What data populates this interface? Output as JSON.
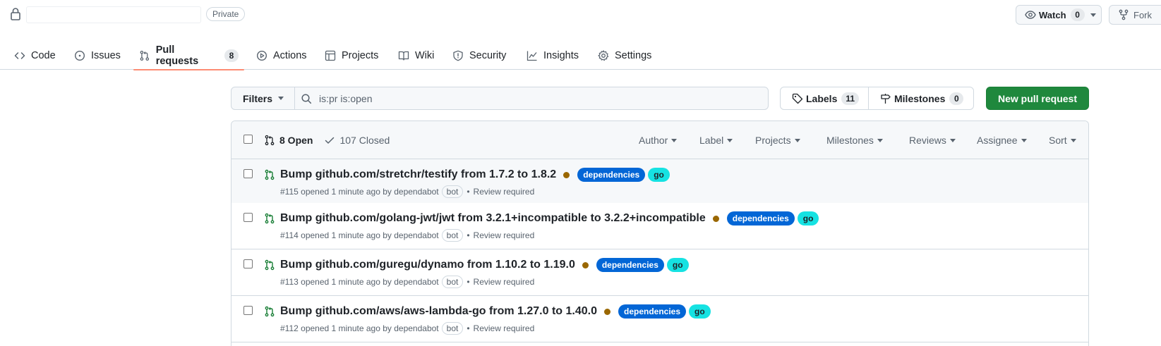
{
  "repo": {
    "visibility": "Private"
  },
  "header_actions": {
    "watch_label": "Watch",
    "watch_count": "0",
    "fork_label": "Fork"
  },
  "tabs": [
    {
      "label": "Code",
      "icon": "code-icon"
    },
    {
      "label": "Issues",
      "icon": "issue-opened-icon"
    },
    {
      "label": "Pull requests",
      "icon": "git-pull-request-icon",
      "counter": "8",
      "selected": true
    },
    {
      "label": "Actions",
      "icon": "play-icon"
    },
    {
      "label": "Projects",
      "icon": "table-icon"
    },
    {
      "label": "Wiki",
      "icon": "book-icon"
    },
    {
      "label": "Security",
      "icon": "shield-icon"
    },
    {
      "label": "Insights",
      "icon": "graph-icon"
    },
    {
      "label": "Settings",
      "icon": "gear-icon"
    }
  ],
  "toolbar": {
    "filters_label": "Filters",
    "search_value": "is:pr is:open",
    "labels_label": "Labels",
    "labels_count": "11",
    "milestones_label": "Milestones",
    "milestones_count": "0",
    "new_pr_label": "New pull request"
  },
  "list_header": {
    "open_label": "8 Open",
    "closed_label": "107 Closed",
    "filters": [
      "Author",
      "Label",
      "Projects",
      "Milestones",
      "Reviews",
      "Assignee",
      "Sort"
    ]
  },
  "pull_requests": [
    {
      "title": "Bump github.com/stretchr/testify from 1.7.2 to 1.8.2",
      "labels": [
        "dependencies",
        "go"
      ],
      "meta": "#115 opened 1 minute ago by dependabot",
      "bot": "bot",
      "review": "Review required"
    },
    {
      "title": "Bump github.com/golang-jwt/jwt from 3.2.1+incompatible to 3.2.2+incompatible",
      "labels": [
        "dependencies",
        "go"
      ],
      "meta": "#114 opened 1 minute ago by dependabot",
      "bot": "bot",
      "review": "Review required"
    },
    {
      "title": "Bump github.com/guregu/dynamo from 1.10.2 to 1.19.0",
      "labels": [
        "dependencies",
        "go"
      ],
      "meta": "#113 opened 1 minute ago by dependabot",
      "bot": "bot",
      "review": "Review required"
    },
    {
      "title": "Bump github.com/aws/aws-lambda-go from 1.27.0 to 1.40.0",
      "labels": [
        "dependencies",
        "go"
      ],
      "meta": "#112 opened 1 minute ago by dependabot",
      "bot": "bot",
      "review": "Review required"
    }
  ],
  "colors": {
    "accent_tab_underline": "#fd8c73",
    "primary_button": "#1f883d",
    "pr_open_icon": "#1a7f37",
    "label_dependencies": "#0366d6",
    "label_go": "#16e2e2",
    "status_pending": "#9a6700"
  }
}
